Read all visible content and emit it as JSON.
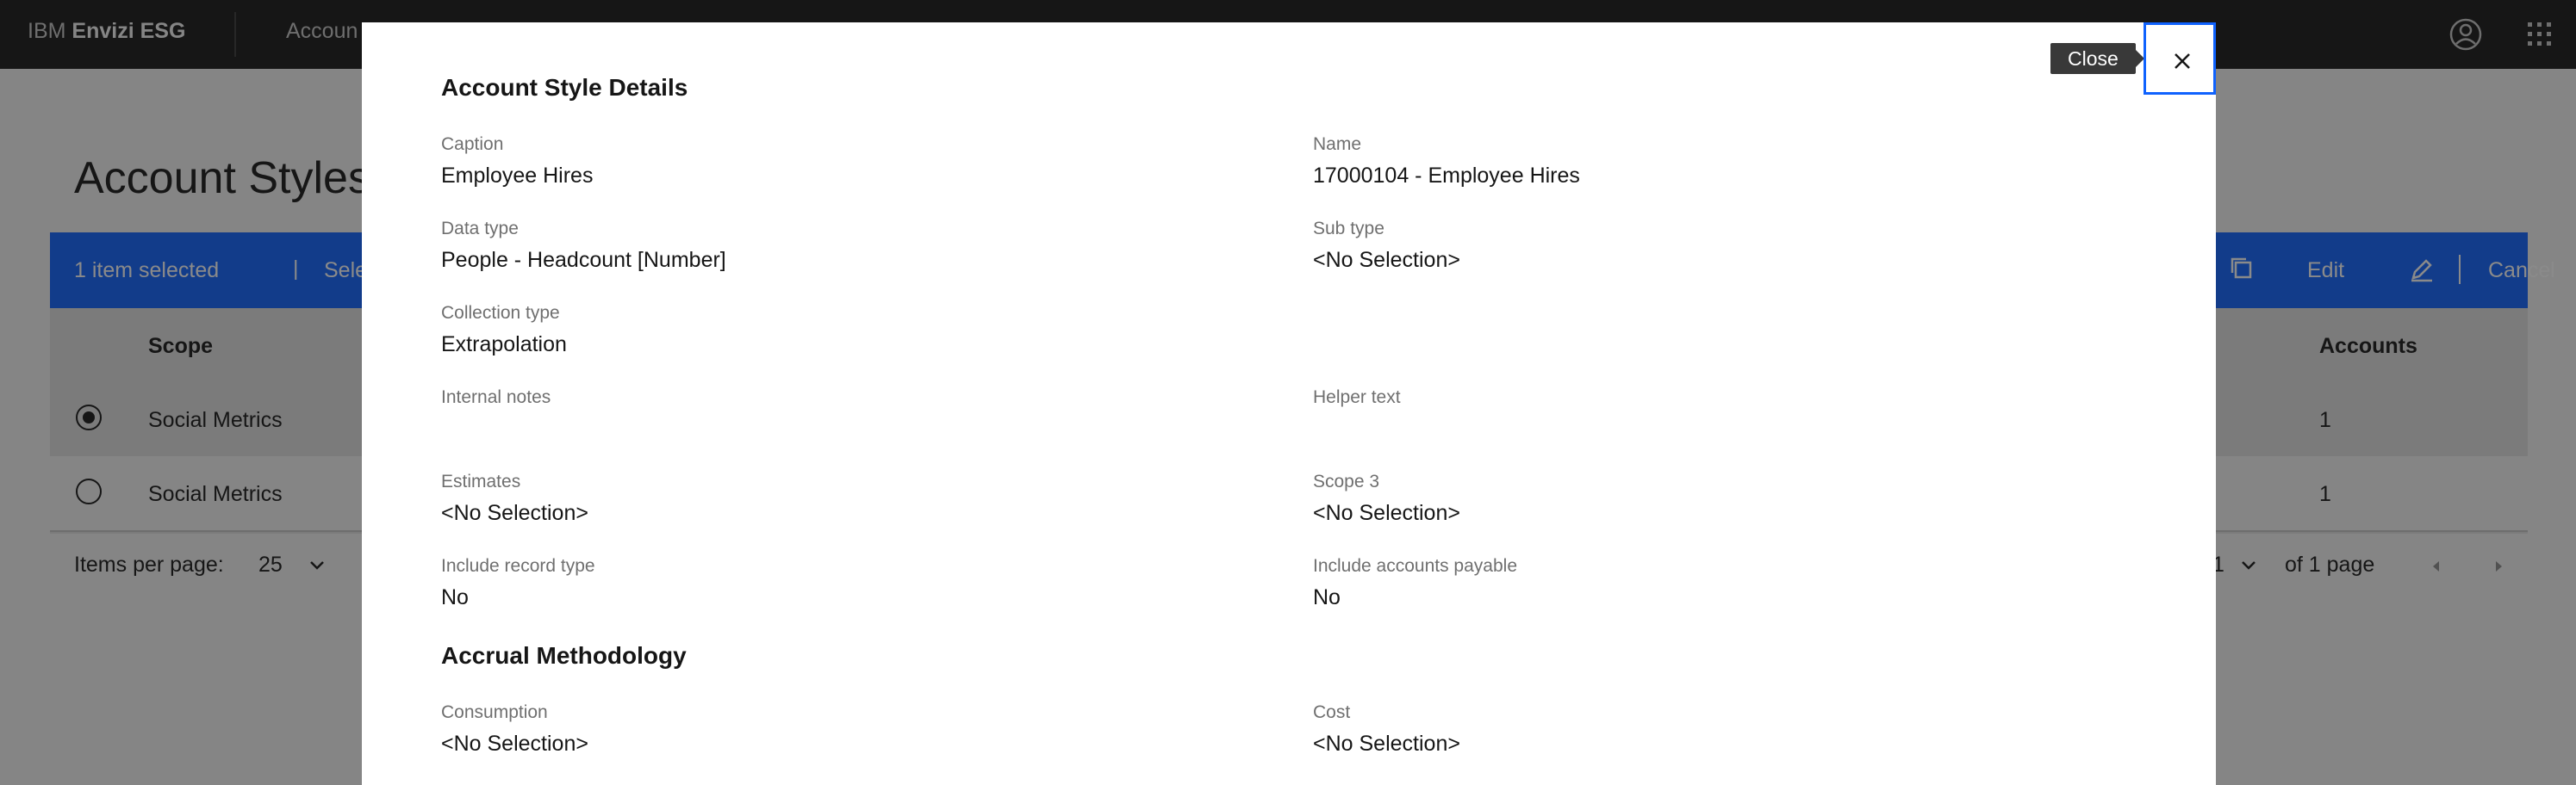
{
  "header": {
    "brand_prefix": "IBM",
    "brand_name": "Envizi ESG",
    "nav_item": "Accoun"
  },
  "page": {
    "title": "Account Styles"
  },
  "selection_bar": {
    "count_label": "1 item selected",
    "separator": "|",
    "select_all_label": "Select al",
    "edit_label": "Edit",
    "cancel_label": "Cancel"
  },
  "table": {
    "columns": {
      "scope": "Scope",
      "accounts": "Accounts"
    },
    "rows": [
      {
        "scope": "Social Metrics",
        "accounts": "1",
        "selected": true
      },
      {
        "scope": "Social Metrics",
        "accounts": "1",
        "selected": false
      }
    ]
  },
  "pagination": {
    "items_per_page_label": "Items per page:",
    "items_per_page_value": "25",
    "page_value": "1",
    "of_pages_label": "of 1 page"
  },
  "modal": {
    "section_details": "Account Style Details",
    "section_accrual": "Accrual Methodology",
    "close_tooltip": "Close",
    "fields": {
      "caption": {
        "label": "Caption",
        "value": "Employee Hires"
      },
      "name": {
        "label": "Name",
        "value": "17000104 - Employee Hires"
      },
      "data_type": {
        "label": "Data type",
        "value": "People - Headcount [Number]"
      },
      "sub_type": {
        "label": "Sub type",
        "value": "<No Selection>"
      },
      "collection_type": {
        "label": "Collection type",
        "value": "Extrapolation"
      },
      "internal_notes": {
        "label": "Internal notes",
        "value": ""
      },
      "helper_text": {
        "label": "Helper text",
        "value": ""
      },
      "estimates": {
        "label": "Estimates",
        "value": "<No Selection>"
      },
      "scope3": {
        "label": "Scope 3",
        "value": "<No Selection>"
      },
      "include_record_type": {
        "label": "Include record type",
        "value": "No"
      },
      "include_accounts_payable": {
        "label": "Include accounts payable",
        "value": "No"
      },
      "consumption": {
        "label": "Consumption",
        "value": "<No Selection>"
      },
      "cost": {
        "label": "Cost",
        "value": "<No Selection>"
      }
    }
  },
  "colors": {
    "accent": "#0f62fe",
    "header_bg": "#161616",
    "overlay": "rgba(22,22,22,0.5)"
  },
  "icons": [
    "user-avatar-icon",
    "app-switcher-icon",
    "copy-icon",
    "edit-pencil-icon",
    "chevron-down-icon",
    "caret-left-icon",
    "caret-right-icon",
    "close-icon"
  ]
}
